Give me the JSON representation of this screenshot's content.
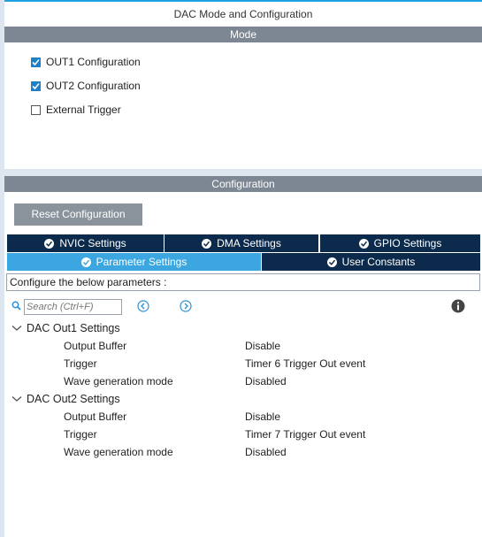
{
  "window": {
    "title": "DAC Mode and Configuration"
  },
  "mode": {
    "header": "Mode",
    "options": [
      {
        "label": "OUT1 Configuration",
        "checked": true
      },
      {
        "label": "OUT2 Configuration",
        "checked": true
      },
      {
        "label": "External Trigger",
        "checked": false
      }
    ]
  },
  "configuration": {
    "header": "Configuration",
    "reset_label": "Reset Configuration",
    "tabs_row1": [
      "NVIC Settings",
      "DMA Settings",
      "GPIO Settings"
    ],
    "tabs_row2": [
      "Parameter Settings",
      "User Constants"
    ],
    "active_tab": "Parameter Settings",
    "hint": "Configure the below parameters :",
    "search_placeholder": "Search (Ctrl+F)",
    "groups": [
      {
        "title": "DAC Out1 Settings",
        "params": [
          {
            "name": "Output Buffer",
            "value": "Disable"
          },
          {
            "name": "Trigger",
            "value": "Timer 6 Trigger Out event"
          },
          {
            "name": "Wave generation mode",
            "value": "Disabled"
          }
        ]
      },
      {
        "title": "DAC Out2 Settings",
        "params": [
          {
            "name": "Output Buffer",
            "value": "Disable"
          },
          {
            "name": "Trigger",
            "value": "Timer 7 Trigger Out event"
          },
          {
            "name": "Wave generation mode",
            "value": "Disabled"
          }
        ]
      }
    ]
  },
  "colors": {
    "accent": "#3ba6df",
    "tab_dark": "#0b2a4c",
    "header_gray": "#7d8793",
    "check_blue": "#1d7fc7"
  },
  "icons": {
    "search": "search-icon",
    "prev": "prev-arrow-icon",
    "next": "next-arrow-icon",
    "info": "info-icon",
    "tab_ok": "check-circle-icon",
    "collapse": "chevron-down-icon"
  }
}
